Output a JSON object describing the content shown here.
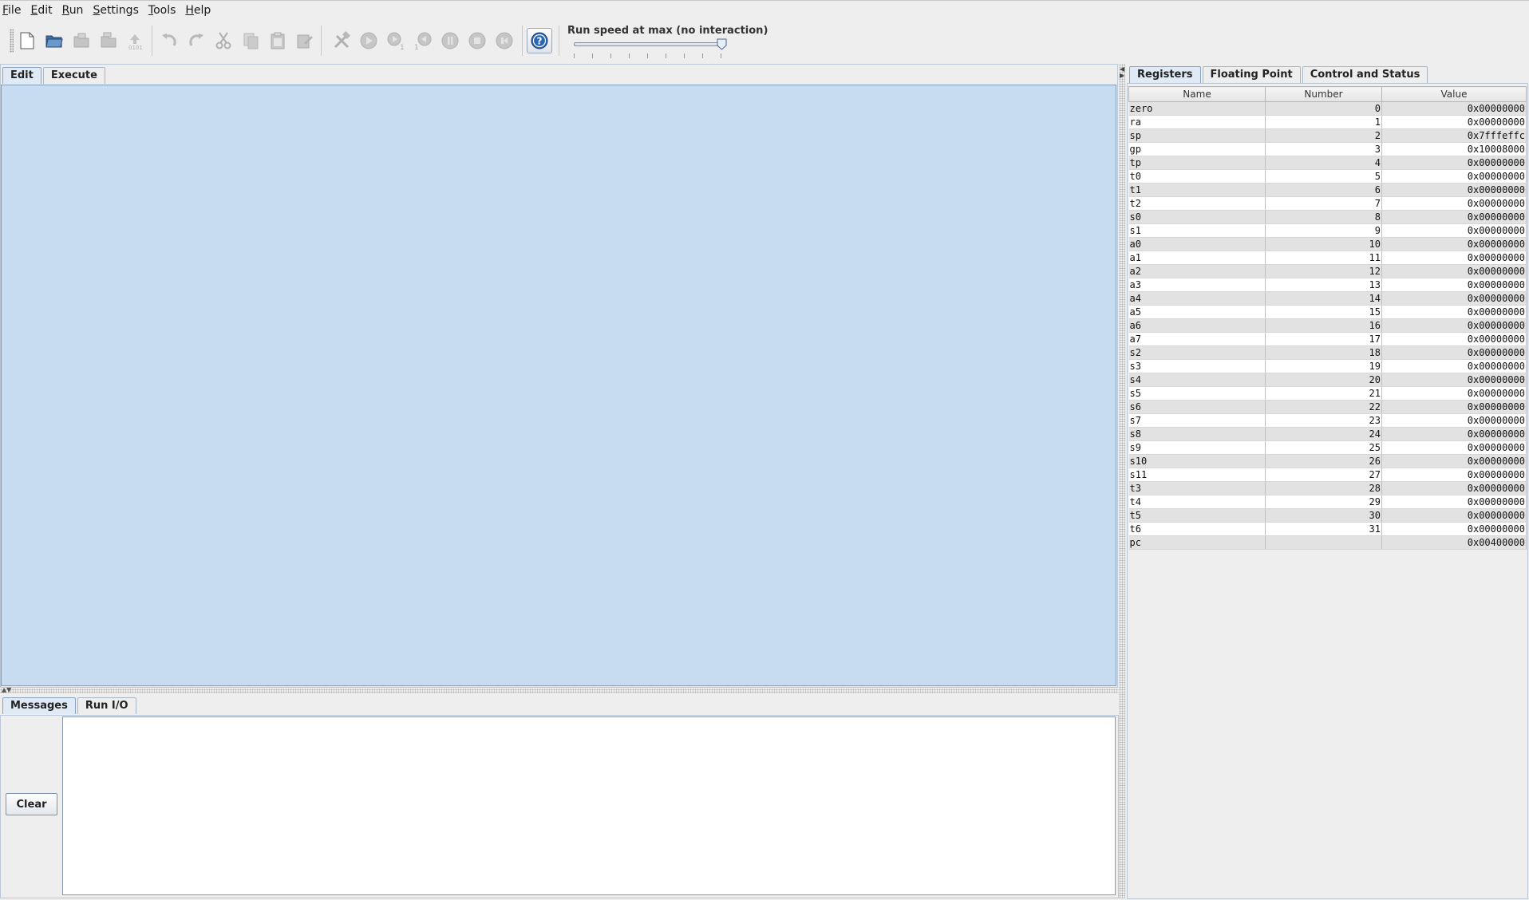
{
  "menu": [
    {
      "mnemonic": "F",
      "rest": "ile"
    },
    {
      "mnemonic": "E",
      "rest": "dit"
    },
    {
      "mnemonic": "R",
      "rest": "un"
    },
    {
      "mnemonic": "S",
      "rest": "ettings"
    },
    {
      "mnemonic": "T",
      "rest": "ools"
    },
    {
      "mnemonic": "H",
      "rest": "elp"
    }
  ],
  "toolbar": {
    "speed_label": "Run speed at max (no interaction)",
    "speed_level": 1.0,
    "buttons": [
      {
        "name": "new-file-icon",
        "enabled": true
      },
      {
        "name": "open-file-icon",
        "enabled": true
      },
      {
        "name": "save-file-icon",
        "enabled": false
      },
      {
        "name": "save-as-icon",
        "enabled": false
      },
      {
        "name": "dump-memory-icon",
        "enabled": false,
        "text": "0101"
      },
      {
        "name": "undo-icon",
        "enabled": false
      },
      {
        "name": "redo-icon",
        "enabled": false
      },
      {
        "name": "cut-icon",
        "enabled": false
      },
      {
        "name": "copy-icon",
        "enabled": false
      },
      {
        "name": "paste-icon",
        "enabled": false
      },
      {
        "name": "find-replace-icon",
        "enabled": false
      },
      {
        "name": "assemble-icon",
        "enabled": false
      },
      {
        "name": "run-icon",
        "enabled": false
      },
      {
        "name": "step-icon",
        "enabled": false,
        "text": "1"
      },
      {
        "name": "backstep-icon",
        "enabled": false,
        "text": "1"
      },
      {
        "name": "pause-icon",
        "enabled": false
      },
      {
        "name": "stop-icon",
        "enabled": false
      },
      {
        "name": "reset-icon",
        "enabled": false
      },
      {
        "name": "help-icon",
        "enabled": true,
        "text": "?"
      }
    ]
  },
  "editor": {
    "tabs": [
      "Edit",
      "Execute"
    ],
    "active_tab": "Edit"
  },
  "messages": {
    "tabs": [
      "Messages",
      "Run I/O"
    ],
    "active_tab": "Messages",
    "clear_label": "Clear",
    "text": ""
  },
  "registers": {
    "tabs": [
      "Registers",
      "Floating Point",
      "Control and Status"
    ],
    "active_tab": "Registers",
    "columns": [
      "Name",
      "Number",
      "Value"
    ],
    "rows": [
      [
        "zero",
        "0",
        "0x00000000"
      ],
      [
        "ra",
        "1",
        "0x00000000"
      ],
      [
        "sp",
        "2",
        "0x7fffeffc"
      ],
      [
        "gp",
        "3",
        "0x10008000"
      ],
      [
        "tp",
        "4",
        "0x00000000"
      ],
      [
        "t0",
        "5",
        "0x00000000"
      ],
      [
        "t1",
        "6",
        "0x00000000"
      ],
      [
        "t2",
        "7",
        "0x00000000"
      ],
      [
        "s0",
        "8",
        "0x00000000"
      ],
      [
        "s1",
        "9",
        "0x00000000"
      ],
      [
        "a0",
        "10",
        "0x00000000"
      ],
      [
        "a1",
        "11",
        "0x00000000"
      ],
      [
        "a2",
        "12",
        "0x00000000"
      ],
      [
        "a3",
        "13",
        "0x00000000"
      ],
      [
        "a4",
        "14",
        "0x00000000"
      ],
      [
        "a5",
        "15",
        "0x00000000"
      ],
      [
        "a6",
        "16",
        "0x00000000"
      ],
      [
        "a7",
        "17",
        "0x00000000"
      ],
      [
        "s2",
        "18",
        "0x00000000"
      ],
      [
        "s3",
        "19",
        "0x00000000"
      ],
      [
        "s4",
        "20",
        "0x00000000"
      ],
      [
        "s5",
        "21",
        "0x00000000"
      ],
      [
        "s6",
        "22",
        "0x00000000"
      ],
      [
        "s7",
        "23",
        "0x00000000"
      ],
      [
        "s8",
        "24",
        "0x00000000"
      ],
      [
        "s9",
        "25",
        "0x00000000"
      ],
      [
        "s10",
        "26",
        "0x00000000"
      ],
      [
        "s11",
        "27",
        "0x00000000"
      ],
      [
        "t3",
        "28",
        "0x00000000"
      ],
      [
        "t4",
        "29",
        "0x00000000"
      ],
      [
        "t5",
        "30",
        "0x00000000"
      ],
      [
        "t6",
        "31",
        "0x00000000"
      ],
      [
        "pc",
        "",
        "0x00400000"
      ]
    ]
  },
  "colors": {
    "editor_bg": "#c7dcf0",
    "disabled_icon": "#b3b3b3",
    "help_icon": "#2a66b5"
  }
}
